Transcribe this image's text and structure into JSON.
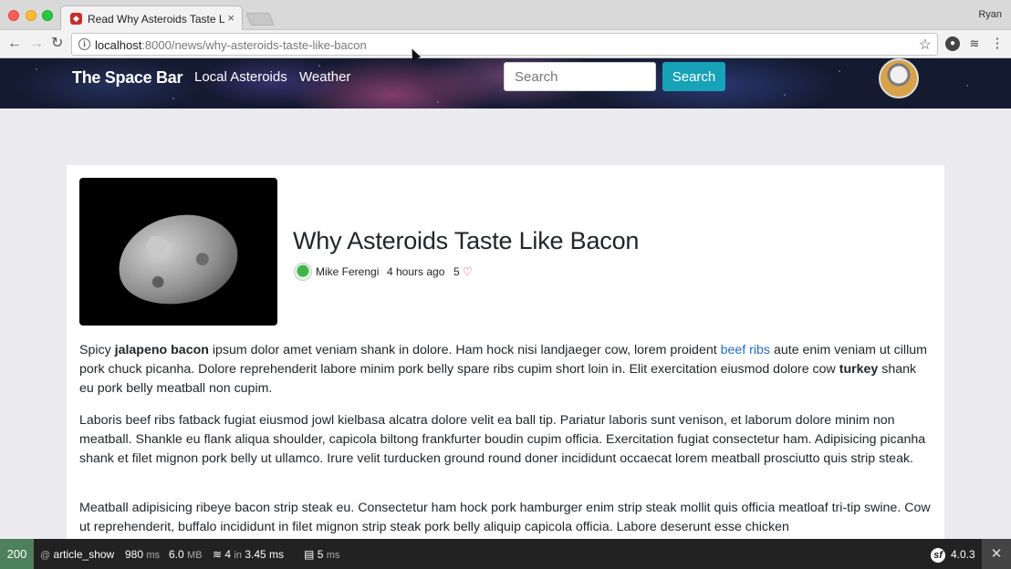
{
  "browser": {
    "tab_title": "Read Why Asteroids Taste Like Bacon",
    "tab_close": "×",
    "profile_name": "Ryan",
    "url_host": "localhost",
    "url_path": ":8000/news/why-asteroids-taste-like-bacon"
  },
  "site": {
    "brand": "The Space Bar",
    "nav": {
      "local": "Local Asteroids",
      "weather": "Weather"
    },
    "search": {
      "placeholder": "Search",
      "button": "Search"
    }
  },
  "article": {
    "title": "Why Asteroids Taste Like Bacon",
    "author": "Mike Ferengi",
    "time": "4 hours ago",
    "hearts": "5",
    "p1": {
      "a": "Spicy ",
      "b_bold": "jalapeno bacon",
      "c": " ipsum dolor amet veniam shank in dolore. Ham hock nisi landjaeger cow, lorem proident ",
      "link": "beef ribs",
      "d": " aute enim veniam ut cillum pork chuck picanha. Dolore reprehenderit labore minim pork belly spare ribs cupim short loin in. Elit exercitation eiusmod dolore cow ",
      "e_bold": "turkey",
      "f": " shank eu pork belly meatball non cupim."
    },
    "p2": "Laboris beef ribs fatback fugiat eiusmod jowl kielbasa alcatra dolore velit ea ball tip. Pariatur laboris sunt venison, et laborum dolore minim non meatball. Shankle eu flank aliqua shoulder, capicola biltong frankfurter boudin cupim officia. Exercitation fugiat consectetur ham. Adipisicing picanha shank et filet mignon pork belly ut ullamco. Irure velit turducken ground round doner incididunt occaecat lorem meatball prosciutto quis strip steak.",
    "p3": "Meatball adipisicing ribeye bacon strip steak eu. Consectetur ham hock pork hamburger enim strip steak mollit quis officia meatloaf tri-tip swine. Cow ut reprehenderit, buffalo incididunt in filet mignon strip steak pork belly aliquip capicola officia. Labore deserunt esse chicken"
  },
  "profiler": {
    "status": "200",
    "route": "article_show",
    "time_value": "980",
    "time_unit": "ms",
    "memory_value": "6.0",
    "memory_unit": "MB",
    "db_queries": "4",
    "db_in": "in",
    "db_time": "3.45 ms",
    "cache_time": "5",
    "cache_unit": "ms",
    "version": "4.0.3",
    "close": "✕"
  },
  "colors": {
    "accent": "#17a2b8",
    "status_ok": "#4f805d",
    "heart": "#dc3545",
    "link": "#1f6fc4"
  }
}
